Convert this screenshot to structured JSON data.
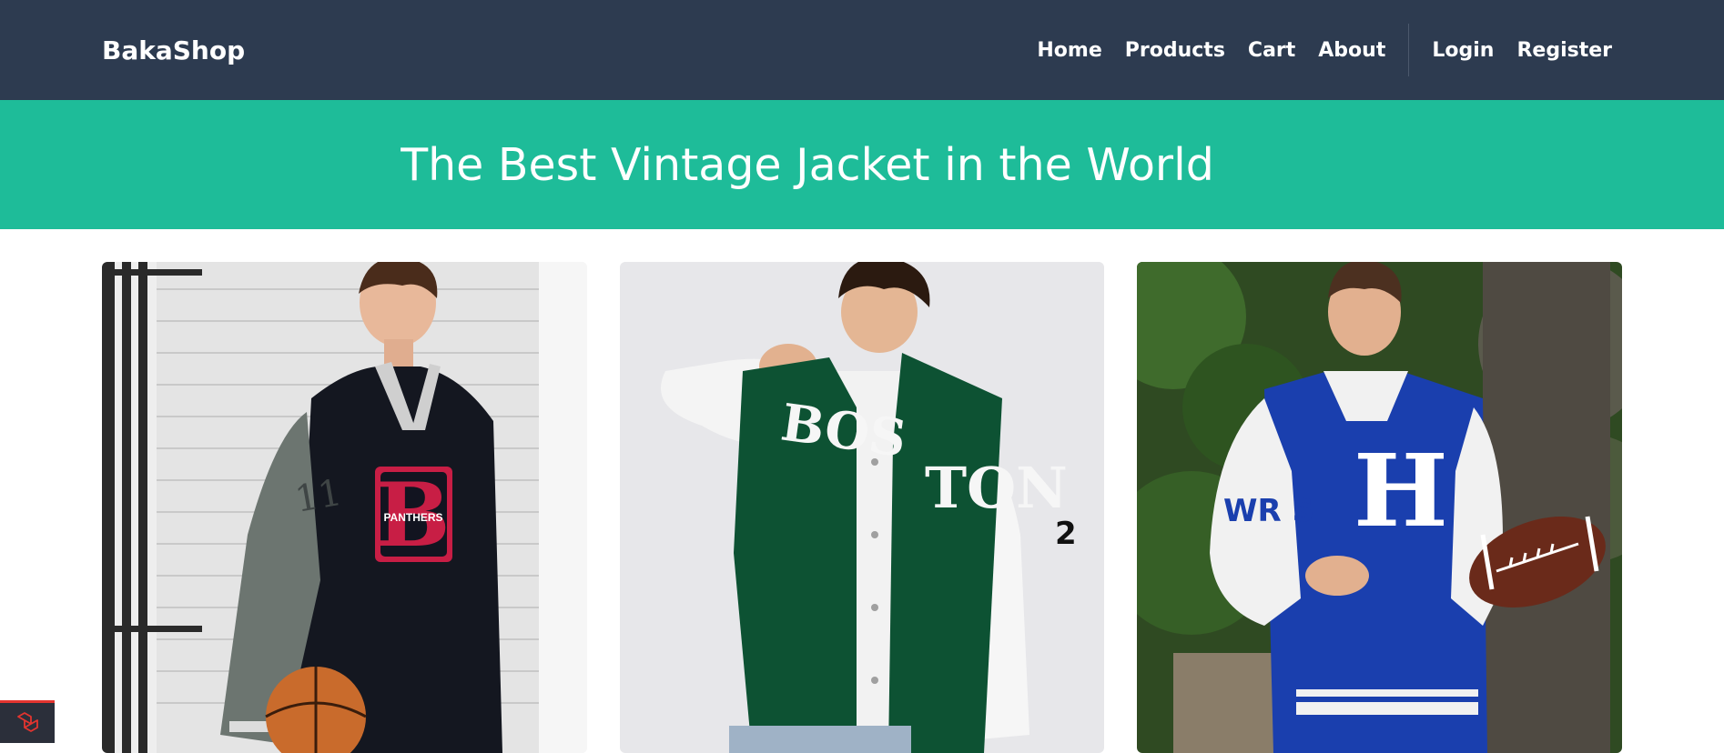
{
  "navbar": {
    "brand": "BakaShop",
    "links": [
      {
        "label": "Home"
      },
      {
        "label": "Products"
      },
      {
        "label": "Cart"
      },
      {
        "label": "About"
      }
    ],
    "auth": [
      {
        "label": "Login"
      },
      {
        "label": "Register"
      }
    ]
  },
  "hero": {
    "title": "The Best Vintage Jacket in the World"
  },
  "products": [
    {
      "jacket_text": "B",
      "patch_text": "PANTHERS",
      "sleeve_number": "11",
      "ball": "basketball-icon"
    },
    {
      "jacket_text_left": "BOS",
      "jacket_text_right": "TON",
      "sleeve_number": "2"
    },
    {
      "jacket_text": "H",
      "sleeve_text": "WR S",
      "ball": "football-icon"
    }
  ],
  "debug_badge": {
    "icon": "laravel-logo-icon"
  },
  "colors": {
    "navbar_bg": "#2d3b50",
    "hero_bg": "#1ebc99",
    "text_light": "#ffffff"
  }
}
